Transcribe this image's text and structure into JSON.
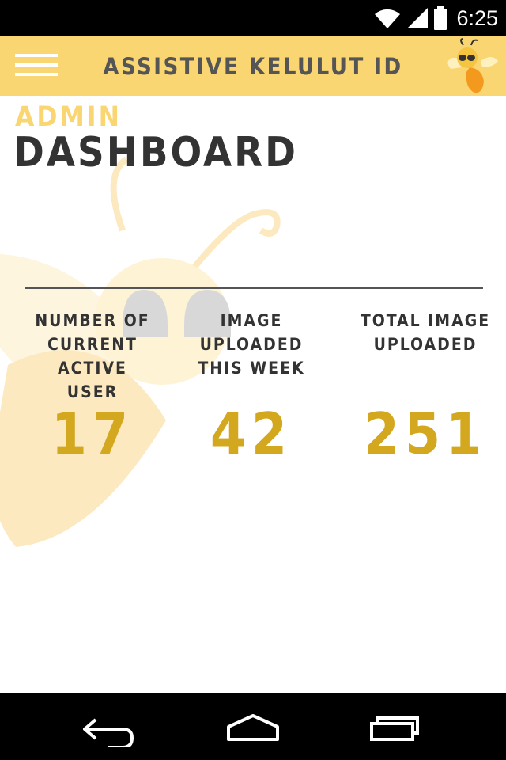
{
  "status_bar": {
    "time": "6:25",
    "icons": [
      "wifi-icon",
      "cell-signal-icon",
      "battery-icon"
    ]
  },
  "app_bar": {
    "title": "ASSISTIVE KELULUT ID",
    "menu_icon": "hamburger-menu-icon",
    "logo_icon": "bee-logo-icon"
  },
  "page": {
    "subtitle": "ADMIN",
    "title": "DASHBOARD"
  },
  "stats": [
    {
      "label_lines": [
        "NUMBER OF",
        "CURRENT ACTIVE",
        "USER"
      ],
      "value": "17"
    },
    {
      "label_lines": [
        "IMAGE UPLOADED",
        "THIS WEEK"
      ],
      "value": "42"
    },
    {
      "label_lines": [
        "TOTAL IMAGE",
        "UPLOADED"
      ],
      "value": "251"
    }
  ],
  "nav_bar": {
    "back_icon": "back-icon",
    "home_icon": "home-icon",
    "recents_icon": "recents-icon"
  },
  "colors": {
    "accent": "#fad673",
    "value": "#d3a81f",
    "text": "#333333"
  }
}
